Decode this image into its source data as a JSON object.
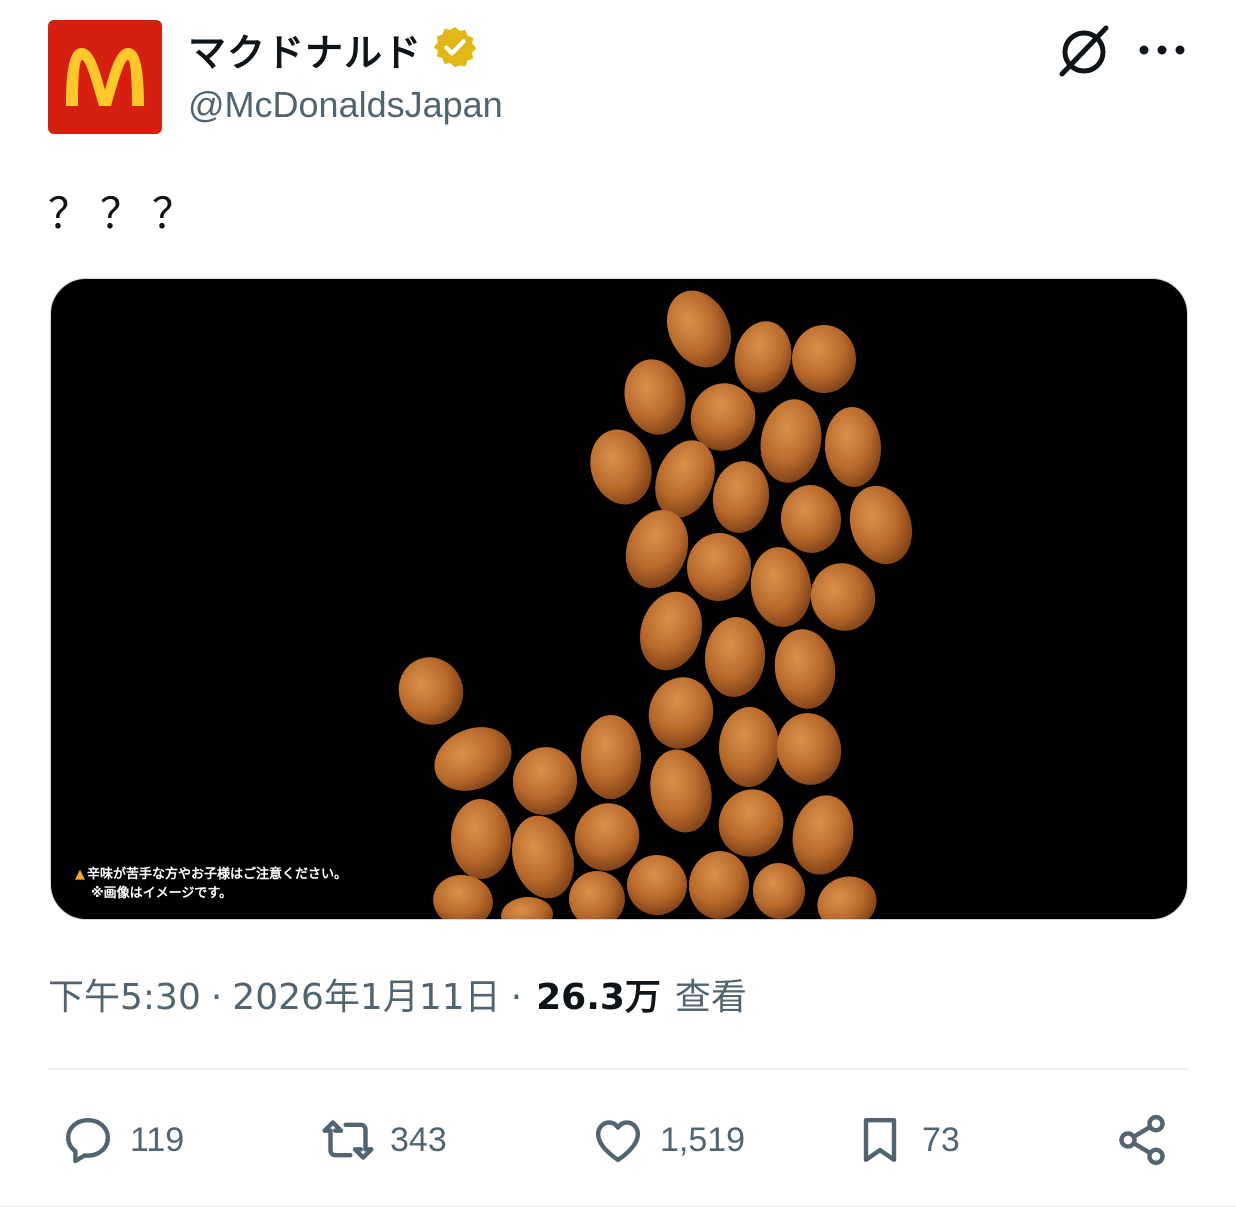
{
  "author": {
    "display_name": "マクドナルド",
    "handle": "@McDonaldsJapan",
    "verified_badge_icon": "verified-gold-badge-icon",
    "logo_letter": "M",
    "brand_colors": {
      "red": "#d71f0f",
      "gold": "#ffc72c"
    }
  },
  "header": {
    "grok_icon": "grok-icon",
    "more_icon": "more-horizontal-icon"
  },
  "tweet": {
    "text": "？？？",
    "media_warning_line1": "辛味が苦手な方やお子様はご注意ください。",
    "media_warning_line2": "※画像はイメージです。",
    "media_description_icon": "warning-triangle-icon"
  },
  "meta": {
    "time": "下午5:30",
    "separator": "·",
    "date": "2026年1月11日",
    "views": "26.3万",
    "views_label": "查看"
  },
  "actions": {
    "reply": {
      "icon": "reply-icon",
      "count": "119"
    },
    "retweet": {
      "icon": "retweet-icon",
      "count": "343"
    },
    "like": {
      "icon": "heart-icon",
      "count": "1,519"
    },
    "bookmark": {
      "icon": "bookmark-icon",
      "count": "73"
    },
    "share": {
      "icon": "share-icon"
    }
  },
  "colors": {
    "text_primary": "#0f1419",
    "text_secondary": "#536471",
    "nugget": "#b8692c"
  }
}
